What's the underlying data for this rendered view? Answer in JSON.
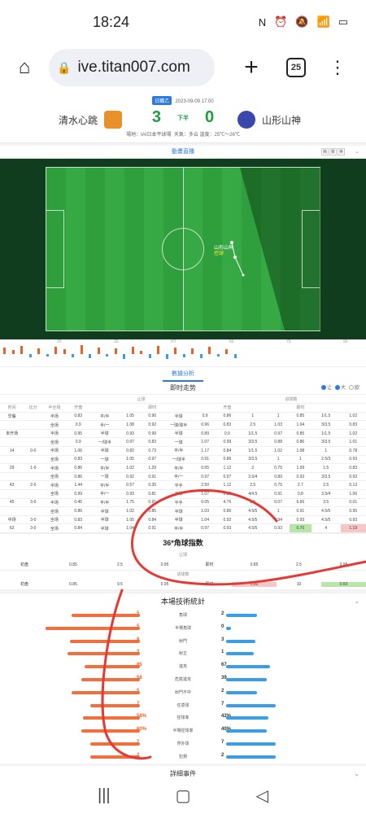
{
  "status_bar": {
    "time": "18:24",
    "icons": [
      "nfc-icon",
      "alarm-icon",
      "mute-icon",
      "wifi-icon",
      "battery-icon"
    ],
    "icon_glyphs": [
      "N",
      "⏰",
      "🔕",
      "📶",
      "▭"
    ]
  },
  "browser": {
    "url": "ive.titan007.com",
    "tab_count": "25",
    "home_glyph": "⌂",
    "plus_glyph": "+",
    "menu_glyph": "⋮",
    "lock_glyph": "🔒"
  },
  "match": {
    "home_team": "清水心跳",
    "away_team": "山形山神",
    "round_badge": "日職乙",
    "datetime": "2023-09-09 17:00",
    "home_score": "3",
    "away_score": "0",
    "period": "下半",
    "venue": "場地：IAI日本平球場",
    "weather": "天氣：多云",
    "temperature": "溫度：25℃～26℃"
  },
  "live_anim": {
    "title": "動畫直播",
    "view_toggle": [
      "簡",
      "繁",
      "英"
    ],
    "event_team": "山形山神",
    "event_text": "控球"
  },
  "timeline_ticks": [
    "15",
    "30",
    "HT",
    "60",
    "75",
    "90"
  ],
  "timeline_bars": [
    {
      "h": 8,
      "c": "#e8612a"
    },
    {
      "h": 5,
      "c": "#e8612a"
    },
    {
      "h": 10,
      "c": "#e8612a"
    },
    {
      "h": 4,
      "c": "#3a9ee6"
    },
    {
      "h": 7,
      "c": "#e8612a"
    },
    {
      "h": 3,
      "c": "#3a9ee6"
    },
    {
      "h": 9,
      "c": "#e8612a"
    },
    {
      "h": 6,
      "c": "#e8612a"
    },
    {
      "h": 4,
      "c": "#3a9ee6"
    },
    {
      "h": 11,
      "c": "#e8612a"
    },
    {
      "h": 5,
      "c": "#3a9ee6"
    },
    {
      "h": 8,
      "c": "#e8612a"
    },
    {
      "h": 3,
      "c": "#3a9ee6"
    },
    {
      "h": 7,
      "c": "#e8612a"
    },
    {
      "h": 6,
      "c": "#3a9ee6"
    },
    {
      "h": 9,
      "c": "#e8612a"
    },
    {
      "h": 4,
      "c": "#e8612a"
    },
    {
      "h": 5,
      "c": "#3a9ee6"
    },
    {
      "h": 10,
      "c": "#e8612a"
    },
    {
      "h": 6,
      "c": "#3a9ee6"
    },
    {
      "h": 8,
      "c": "#e8612a"
    },
    {
      "h": 4,
      "c": "#3a9ee6"
    },
    {
      "h": 7,
      "c": "#e8612a"
    },
    {
      "h": 5,
      "c": "#3a9ee6"
    },
    {
      "h": 9,
      "c": "#e8612a"
    },
    {
      "h": 3,
      "c": "#3a9ee6"
    },
    {
      "h": 6,
      "c": "#e8612a"
    },
    {
      "h": 5,
      "c": "#3a9ee6"
    }
  ],
  "analysis": {
    "link": "數據分析"
  },
  "trend": {
    "title": "即时走势",
    "options": [
      "让",
      "大",
      "欧"
    ],
    "col_headers": [
      "时间",
      "比分",
      "半全场",
      "开盘",
      "",
      "",
      "即时",
      "",
      "",
      "开盘",
      "",
      "",
      "即时",
      "",
      ""
    ],
    "group_headers": {
      "handicap": "让球",
      "overunder": "进球数"
    },
    "rows": [
      [
        "早餐",
        "",
        "半场",
        "0.83",
        "平/半",
        "1.05",
        "0.90",
        "半球",
        "0.9",
        "0.86",
        "1",
        "1",
        "0.85",
        "1/1.5",
        "1.02"
      ],
      [
        "",
        "",
        "全场",
        "0.9",
        "半/一",
        "1.08",
        "0.92",
        "一球/球半",
        "0.96",
        "0.83",
        "2.5",
        "1.03",
        "1.04",
        "3/3.5",
        "0.83"
      ],
      [
        "未开场",
        "",
        "半场",
        "0.95",
        "半球",
        "0.93",
        "0.99",
        "半球",
        "0.89",
        "0.9",
        "1/1.5",
        "0.97",
        "0.85",
        "1/1.5",
        "1.02"
      ],
      [
        "",
        "",
        "全场",
        "0.9",
        "一/球半",
        "0.97",
        "0.83",
        "一球",
        "1.07",
        "0.99",
        "3/3.5",
        "0.88",
        "0.86",
        "3/3.5",
        "1.01"
      ],
      [
        "14",
        "0-0",
        "半场",
        "1.06",
        "半球",
        "0.82",
        "0.73",
        "平/半",
        "1.17",
        "0.84",
        "1/1.5",
        "1.02",
        "1.08",
        "1",
        "0.78"
      ],
      [
        "",
        "",
        "全场",
        "0.83",
        "一球",
        "1.05",
        "0.97",
        "一/球半",
        "0.91",
        "0.86",
        "3/3.5",
        "1",
        "1",
        "2.5/3",
        "0.93"
      ],
      [
        "29",
        "1-0",
        "半场",
        "0.86",
        "平/半",
        "1.02",
        "1.29",
        "平/半",
        "0.65",
        "1.12",
        "2",
        "0.75",
        "1.09",
        "1.5",
        "0.83"
      ],
      [
        "",
        "",
        "全场",
        "0.86",
        "一球",
        "0.92",
        "0.91",
        "半/一",
        "0.97",
        "0.97",
        "3.5/4",
        "0.89",
        "0.93",
        "3/3.5",
        "0.93"
      ],
      [
        "43",
        "2-0",
        "半场",
        "1.44",
        "平/半",
        "0.57",
        "0.35",
        "平手",
        "2.50",
        "1.12",
        "2.5",
        "0.75",
        "2.7",
        "2.5",
        "0.13"
      ],
      [
        "",
        "",
        "全场",
        "0.99",
        "半/一",
        "0.93",
        "0.81",
        "半球",
        "1.07",
        "0.86",
        "4/4.5",
        "0.91",
        "0.8",
        "3.5/4",
        "1.06"
      ],
      [
        "45",
        "3-0",
        "半场",
        "0.45",
        "平/半",
        "1.75",
        "0.91",
        "平手",
        "0.05",
        "4.76",
        "3.5",
        "0.07",
        "6.66",
        "3.5",
        "0.01"
      ],
      [
        "",
        "",
        "全场",
        "0.86",
        "半球",
        "1.02",
        "0.85",
        "半球",
        "1.03",
        "0.86",
        "4.5/5",
        "1",
        "0.91",
        "4.5/5",
        "0.95"
      ],
      [
        "中场",
        "3-0",
        "全场",
        "0.83",
        "半球",
        "1.05",
        "0.84",
        "半球",
        "1.04",
        "0.92",
        "4.5/5",
        "0.94",
        "0.93",
        "4.5/5",
        "0.93"
      ],
      [
        "62",
        "3-0",
        "全场",
        "0.84",
        "半球",
        "1.04",
        "0.91",
        "平/半",
        "0.97",
        "0.93",
        "4.5/5",
        "0.93",
        "0.70",
        "4",
        "1.19"
      ]
    ]
  },
  "corner": {
    "title": "36*角球指数",
    "handicap_label": "让球",
    "handicap_row": {
      "label": "初盘",
      "values": [
        "0.85",
        "2.5",
        "0.95",
        "即时",
        "0.85",
        "2.5",
        "0.95"
      ]
    },
    "ou_label": "进球数",
    "ou_row": {
      "label": "初盘",
      "values": [
        "0.85",
        "9.5",
        "0.95",
        "即时",
        "1.30",
        "10",
        "0.60"
      ]
    }
  },
  "tech_stats": {
    "title": "本場技術統計",
    "rows": [
      {
        "label": "角球",
        "home": "5",
        "away": "2",
        "hf": 0.71,
        "af": 0.29
      },
      {
        "label": "半場角球",
        "home": "5",
        "away": "0",
        "hf": 1.0,
        "af": 0.0
      },
      {
        "label": "射門",
        "home": "8",
        "away": "3",
        "hf": 0.73,
        "af": 0.27
      },
      {
        "label": "射正",
        "home": "3",
        "away": "1",
        "hf": 0.75,
        "af": 0.25
      },
      {
        "label": "進攻",
        "home": "85",
        "away": "67",
        "hf": 0.56,
        "af": 0.44
      },
      {
        "label": "危險進攻",
        "home": "58",
        "away": "39",
        "hf": 0.6,
        "af": 0.4
      },
      {
        "label": "射門不中",
        "home": "5",
        "away": "2",
        "hf": 0.71,
        "af": 0.29
      },
      {
        "label": "任意球",
        "home": "7",
        "away": "7",
        "hf": 0.5,
        "af": 0.5
      },
      {
        "label": "控球率",
        "home": "58%",
        "away": "42%",
        "hf": 0.58,
        "af": 0.42
      },
      {
        "label": "半場控球率",
        "home": "60%",
        "away": "40%",
        "hf": 0.6,
        "af": 0.4
      },
      {
        "label": "界外球",
        "home": "7",
        "away": "7",
        "hf": 0.5,
        "af": 0.5
      },
      {
        "label": "犯規",
        "home": "2",
        "away": "2",
        "hf": 0.5,
        "af": 0.5
      }
    ]
  },
  "events": {
    "title": "詳細事件"
  },
  "nav": {
    "recents": "|||",
    "home": "▢",
    "back": "◁"
  },
  "colors": {
    "accent": "#2a7ae2",
    "home_bar": "#f26f3b",
    "away_bar": "#3a9ee6",
    "pitch": "#36a944",
    "scribble": "#e53935"
  }
}
